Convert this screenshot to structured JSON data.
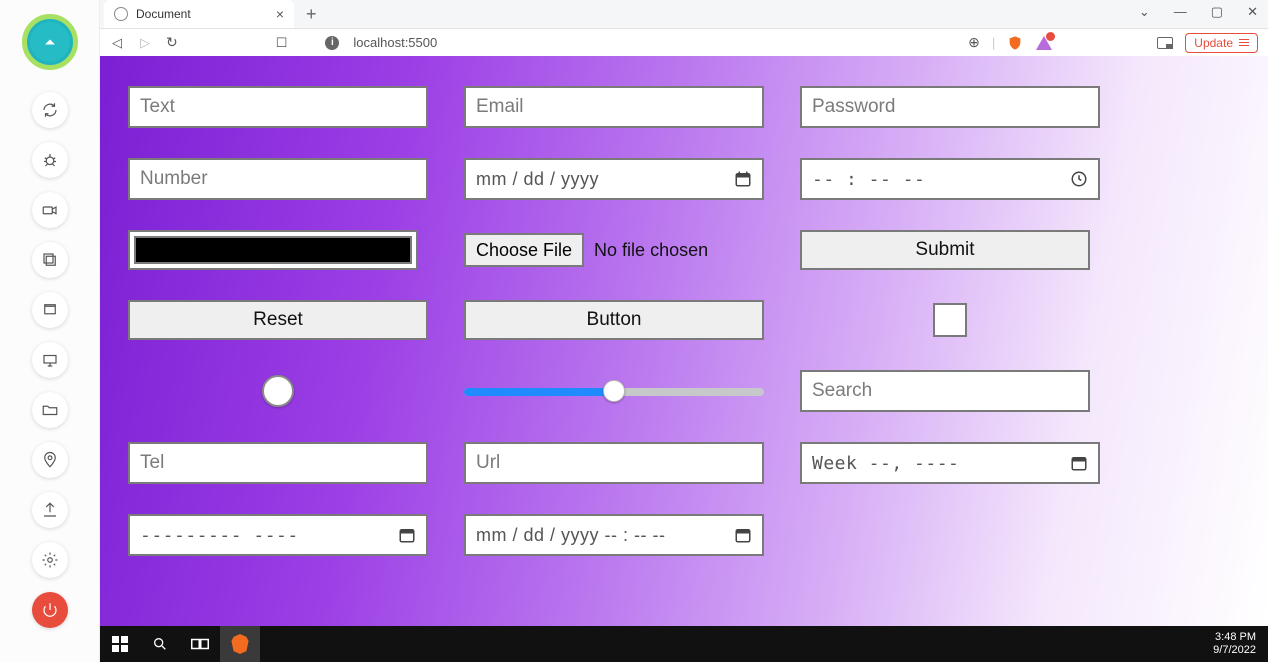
{
  "browser": {
    "tab_title": "Document",
    "url": "localhost:5500",
    "update_label": "Update"
  },
  "inputs": {
    "text_ph": "Text",
    "email_ph": "Email",
    "password_ph": "Password",
    "number_ph": "Number",
    "date_ph": "mm / dd / yyyy",
    "time_ph": "-- : --   --",
    "color_value": "#000000",
    "file_button": "Choose File",
    "file_status": "No file chosen",
    "submit_label": "Submit",
    "reset_label": "Reset",
    "button_label": "Button",
    "range_value": 50,
    "search_ph": "Search",
    "tel_ph": "Tel",
    "url_ph": "Url",
    "week_ph": "Week  --,  ----",
    "month_ph": "---------  ----",
    "datetime_ph": "mm / dd / yyyy  -- : --  --"
  },
  "taskbar": {
    "time": "3:48 PM",
    "date": "9/7/2022"
  }
}
